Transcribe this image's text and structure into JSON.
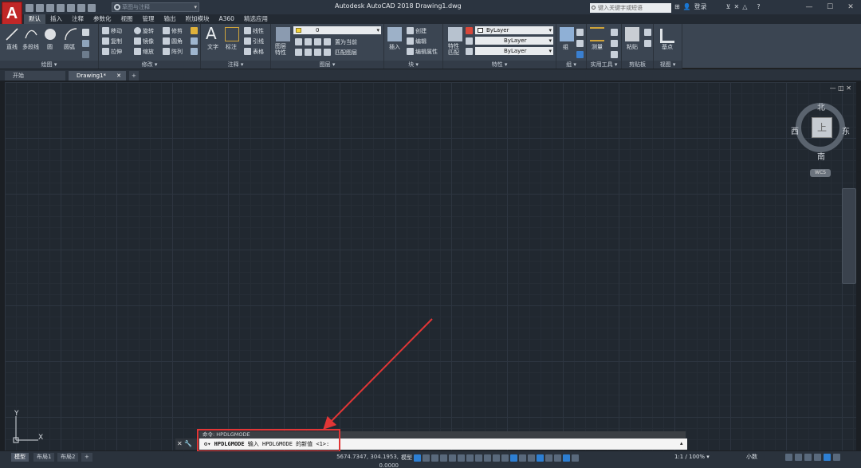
{
  "app": {
    "logo_letter": "A",
    "window_title": "Autodesk AutoCAD 2018    Drawing1.dwg",
    "workspace": "草图与注释",
    "search_placeholder": "键入关键字或短语",
    "login": "登录",
    "help": "?",
    "window_controls": [
      "—",
      "☐",
      "✕"
    ]
  },
  "menu_tabs": [
    "默认",
    "插入",
    "注释",
    "参数化",
    "视图",
    "管理",
    "输出",
    "附加模块",
    "A360",
    "精选应用"
  ],
  "ribbon": {
    "draw": {
      "title": "绘图 ▾",
      "line": "直线",
      "polyline": "多段线",
      "circle": "圆",
      "arc": "圆弧"
    },
    "modify": {
      "title": "修改 ▾",
      "move": "移动",
      "rotate": "旋转",
      "trim": "修剪",
      "copy": "复制",
      "mirror": "镜像",
      "fillet": "圆角",
      "stretch": "拉伸",
      "scale": "缩放",
      "array": "阵列"
    },
    "annotation": {
      "title": "注释 ▾",
      "text": "文字",
      "dimension": "标注",
      "linear": "线性",
      "leader": "引线",
      "table": "表格"
    },
    "layers": {
      "title": "图层 ▾",
      "props": "图层\n特性",
      "layer_value": "0",
      "make_current": "置为当前",
      "match_layer": "匹配图层"
    },
    "block": {
      "title": "块 ▾",
      "insert": "插入",
      "create": "创建",
      "edit": "编辑",
      "edit_attr": "编辑属性"
    },
    "properties": {
      "title": "特性 ▾",
      "match": "特性\n匹配",
      "color": "ByLayer",
      "linetype": "ByLayer",
      "lineweight": "ByLayer"
    },
    "groups": {
      "title": "组 ▾",
      "group": "组"
    },
    "utilities": {
      "title": "实用工具 ▾",
      "measure": "测量"
    },
    "clipboard": {
      "title": "剪贴板",
      "paste": "粘贴"
    },
    "view": {
      "title": "视图 ▾",
      "base": "基点"
    }
  },
  "doc_tabs": {
    "start": "开始",
    "drawing": "Drawing1*",
    "close": "✕",
    "add": "+"
  },
  "viewcube": {
    "north": "北",
    "south": "南",
    "east": "东",
    "west": "西",
    "face": "上",
    "wcs": "WCS"
  },
  "ucs": {
    "x": "X",
    "y": "Y"
  },
  "command": {
    "history": "命令: HPDLGMODE",
    "prompt_name": "HPDLGMODE",
    "prompt_text": " 输入 HPDLGMODE 的新值 <1>:",
    "left_buttons": "✕ 🔧"
  },
  "layout_tabs": [
    "模型",
    "布局1",
    "布局2",
    "+"
  ],
  "status": {
    "coordinates": "5674.7347, 304.1953, 0.0000",
    "model": "模型",
    "scale": "1:1 / 100% ▾",
    "units": "小数"
  },
  "colors": {
    "accent_red": "#e23636",
    "canvas": "#212830",
    "ribbon": "#3b4552"
  }
}
